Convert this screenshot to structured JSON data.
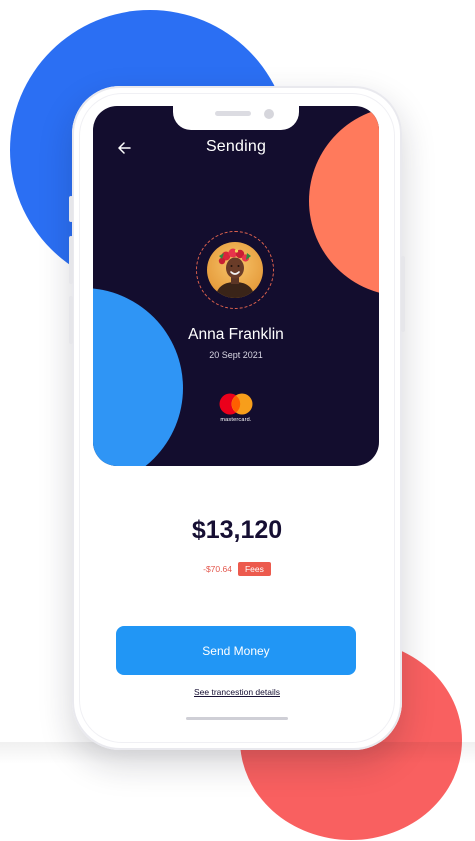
{
  "header": {
    "title": "Sending",
    "back_icon": "arrow-left-icon"
  },
  "recipient": {
    "name": "Anna Franklin",
    "date": "20 Sept 2021",
    "avatar_icon": "avatar-photo"
  },
  "card": {
    "brand_label": "mastercard.",
    "brand_icon": "mastercard-logo-icon"
  },
  "transfer": {
    "amount": "$13,120",
    "fee_amount": "-$70.64",
    "fee_label": "Fees"
  },
  "actions": {
    "send_label": "Send Money",
    "details_link": "See trancestion details"
  },
  "colors": {
    "card_background": "#130d2e",
    "accent_blue": "#2196f5",
    "accent_orange": "#ff7a5c",
    "accent_red": "#ec5a4d",
    "text_dark": "#160f33"
  }
}
